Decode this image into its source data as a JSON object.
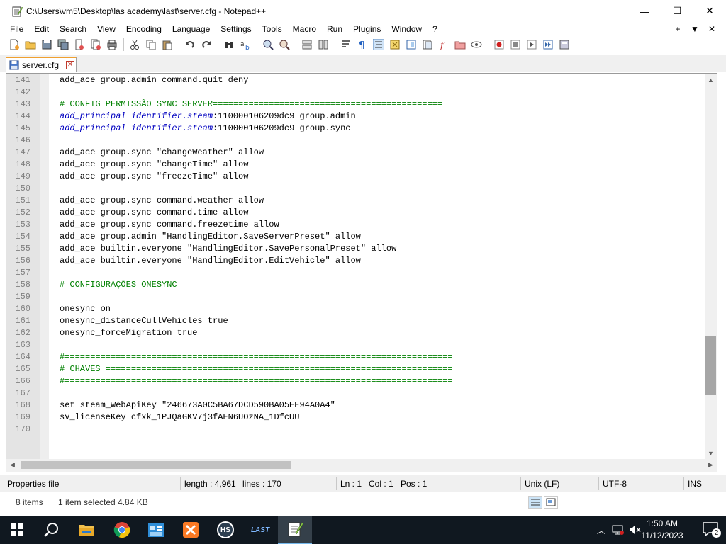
{
  "window": {
    "title": "C:\\Users\\vm5\\Desktop\\las academy\\last\\server.cfg - Notepad++",
    "minimize": "—",
    "maximize": "☐",
    "close": "✕"
  },
  "menu": {
    "items": [
      "File",
      "Edit",
      "Search",
      "View",
      "Encoding",
      "Language",
      "Settings",
      "Tools",
      "Macro",
      "Run",
      "Plugins",
      "Window",
      "?"
    ],
    "right": [
      "+",
      "▼",
      "✕"
    ]
  },
  "tab": {
    "label": "server.cfg",
    "close": "✕"
  },
  "editor": {
    "lines": [
      {
        "n": "141",
        "text": "add_ace group.admin command.quit deny",
        "type": "plain"
      },
      {
        "n": "142",
        "text": "",
        "type": "plain"
      },
      {
        "n": "143",
        "text": "# CONFIG PERMISSÃO SYNC SERVER=============================================",
        "type": "comment"
      },
      {
        "n": "144",
        "kw": "add_principal identifier.steam",
        "text": ":110000106209dc9 group.admin",
        "type": "principal"
      },
      {
        "n": "145",
        "kw": "add_principal identifier.steam",
        "text": ":110000106209dc9 group.sync",
        "type": "principal"
      },
      {
        "n": "146",
        "text": "",
        "type": "plain"
      },
      {
        "n": "147",
        "text": "add_ace group.sync \"changeWeather\" allow",
        "type": "plain"
      },
      {
        "n": "148",
        "text": "add_ace group.sync \"changeTime\" allow",
        "type": "plain"
      },
      {
        "n": "149",
        "text": "add_ace group.sync \"freezeTime\" allow",
        "type": "plain"
      },
      {
        "n": "150",
        "text": "",
        "type": "plain"
      },
      {
        "n": "151",
        "text": "add_ace group.sync command.weather allow",
        "type": "plain"
      },
      {
        "n": "152",
        "text": "add_ace group.sync command.time allow",
        "type": "plain"
      },
      {
        "n": "153",
        "text": "add_ace group.sync command.freezetime allow",
        "type": "plain"
      },
      {
        "n": "154",
        "text": "add_ace group.admin \"HandlingEditor.SaveServerPreset\" allow",
        "type": "plain"
      },
      {
        "n": "155",
        "text": "add_ace builtin.everyone \"HandlingEditor.SavePersonalPreset\" allow",
        "type": "plain"
      },
      {
        "n": "156",
        "text": "add_ace builtin.everyone \"HandlingEditor.EditVehicle\" allow",
        "type": "plain"
      },
      {
        "n": "157",
        "text": "",
        "type": "plain"
      },
      {
        "n": "158",
        "text": "# CONFIGURAÇÕES ONESYNC =====================================================",
        "type": "comment"
      },
      {
        "n": "159",
        "text": "",
        "type": "plain"
      },
      {
        "n": "160",
        "text": "onesync on",
        "type": "plain"
      },
      {
        "n": "161",
        "text": "onesync_distanceCullVehicles true",
        "type": "plain"
      },
      {
        "n": "162",
        "text": "onesync_forceMigration true",
        "type": "plain"
      },
      {
        "n": "163",
        "text": "",
        "type": "plain"
      },
      {
        "n": "164",
        "text": "#============================================================================",
        "type": "comment"
      },
      {
        "n": "165",
        "text": "# CHAVES ====================================================================",
        "type": "comment"
      },
      {
        "n": "166",
        "text": "#============================================================================",
        "type": "comment"
      },
      {
        "n": "167",
        "text": "",
        "type": "plain"
      },
      {
        "n": "168",
        "text": "set steam_WebApiKey \"246673A0C5BA67DCD590BA05EE94A0A4\"",
        "type": "plain"
      },
      {
        "n": "169",
        "text": "sv_licenseKey cfxk_1PJQaGKV7j3fAEN6UOzNA_1DfcUU",
        "type": "plain"
      },
      {
        "n": "170",
        "text": "",
        "type": "plain"
      }
    ]
  },
  "status": {
    "file_type": "Properties file",
    "length": "length : 4,961",
    "lines": "lines : 170",
    "ln": "Ln : 1",
    "col": "Col : 1",
    "pos": "Pos : 1",
    "eol": "Unix (LF)",
    "encoding": "UTF-8",
    "mode": "INS"
  },
  "explorer": {
    "items": "8 items",
    "selected": "1 item selected  4.84 KB"
  },
  "taskbar": {
    "time": "1:50 AM",
    "date": "11/12/2023",
    "notifications": "2",
    "app_last_label": "LAST",
    "app_hs_label": "HS"
  },
  "colors": {
    "comment": "#008000",
    "keyword": "#0000c0",
    "tab_accent": "#f0a030",
    "taskbar": "#101820"
  }
}
